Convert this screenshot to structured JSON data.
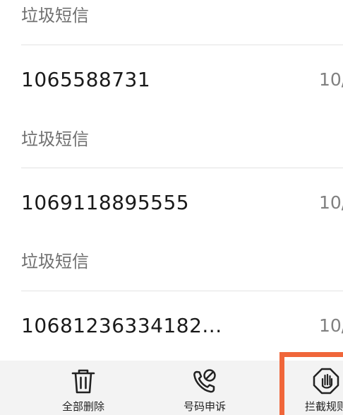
{
  "messages": [
    {
      "category": "垃圾短信"
    },
    {
      "sender": "1065588731",
      "date": "10/",
      "category": "垃圾短信"
    },
    {
      "sender": "1069118895555",
      "date": "10/",
      "category": "垃圾短信"
    },
    {
      "sender": "10681236334182...",
      "date": "10/"
    }
  ],
  "toolbar": {
    "delete_all_label": "全部删除",
    "number_appeal_label": "号码申诉",
    "block_rules_label": "拦截规则"
  },
  "colors": {
    "highlight": "#f0663a",
    "toolbar_bg": "#f3f3f3"
  },
  "icons": {
    "delete_all": "trash-icon",
    "number_appeal": "phone-blocked-icon",
    "block_rules": "hand-stop-icon"
  }
}
